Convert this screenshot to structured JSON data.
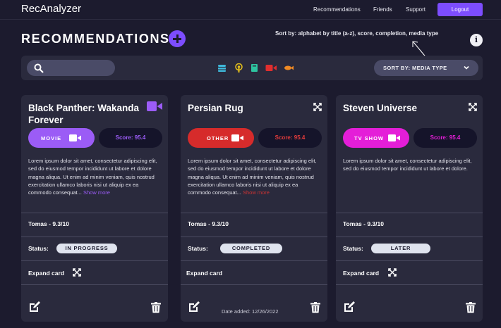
{
  "header": {
    "app_title": "RecAnalyzer",
    "nav": [
      "Recommendations",
      "Friends",
      "Support"
    ],
    "logout_label": "Logout"
  },
  "page": {
    "title": "RECOMMENDATIONS",
    "sort_note": "Sort by: alphabet by title (a-z), score, completion, media type"
  },
  "filter": {
    "search_placeholder": "",
    "media_icons": [
      "tv-icon",
      "podcast-icon",
      "book-icon",
      "video-icon",
      "fish-icon"
    ],
    "sort_label": "SORT BY: MEDIA TYPE"
  },
  "cards": [
    {
      "title": "Black Panther: Wakanda Forever",
      "type": "MOVIE",
      "type_color": "#9b5cf6",
      "score": "Score: 95.4",
      "score_color": "#9b5cf6",
      "description": "Lorem ipsum dolor sit amet, consectetur adipiscing elit, sed do eiusmod tempor incididunt ut labore et dolore magna aliqua. Ut enim ad minim veniam, quis nostrud exercitation ullamco laboris nisi ut aliquip ex ea commodo consequat...",
      "show_more": "Show more",
      "rating": "Tomas - 9.3/10",
      "status_label": "Status:",
      "status": "IN PROGRESS",
      "expand_label": "Expand card"
    },
    {
      "title": "Persian Rug",
      "type": "OTHER",
      "type_color": "#d62b2b",
      "score": "Score: 95.4",
      "score_color": "#e23b3b",
      "description": "Lorem ipsum dolor sit amet, consectetur adipiscing elit, sed do eiusmod tempor incididunt ut labore et dolore magna aliqua. Ut enim ad minim veniam, quis nostrud exercitation ullamco laboris nisi ut aliquip ex ea commodo consequat...",
      "show_more": "Show more",
      "rating": "Tomas - 9.3/10",
      "status_label": "Status:",
      "status": "COMPLETED",
      "expand_label": "Expand card",
      "date_added": "Date added: 12/26/2022"
    },
    {
      "title": "Steven Universe",
      "type": "TV SHOW",
      "type_color": "#e41ed8",
      "score": "Score: 95.4",
      "score_color": "#e41ed8",
      "description": "Lorem ipsum dolor sit amet, consectetur adipiscing elit, sed do eiusmod tempor incididunt ut labore et dolore.",
      "rating": "Tomas - 9.3/10",
      "status_label": "Status:",
      "status": "LATER",
      "expand_label": "Expand card"
    }
  ]
}
